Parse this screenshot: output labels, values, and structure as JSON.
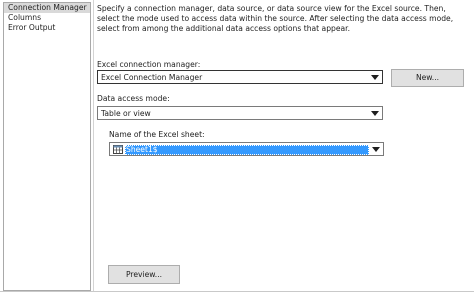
{
  "sidebar": {
    "items": [
      {
        "label": "Connection Manager",
        "selected": true
      },
      {
        "label": "Columns"
      },
      {
        "label": "Error Output"
      }
    ]
  },
  "main": {
    "description": "Specify a connection manager, data source, or data source view for the Excel source. Then, select the mode used to access data within the source. After selecting the data access mode, select from among the additional data access options that appear.",
    "connection_manager": {
      "label": "Excel connection manager:",
      "value": "Excel Connection Manager",
      "new_button": "New..."
    },
    "data_access_mode": {
      "label": "Data access mode:",
      "value": "Table or view"
    },
    "sheet": {
      "label": "Name of the Excel sheet:",
      "value": "Sheet1$",
      "icon": "table-icon"
    },
    "preview_button": "Preview..."
  },
  "colors": {
    "selection": "#3399ff",
    "sidebar_selected": "#d9d9d9",
    "button_bg": "#e1e1e1"
  }
}
